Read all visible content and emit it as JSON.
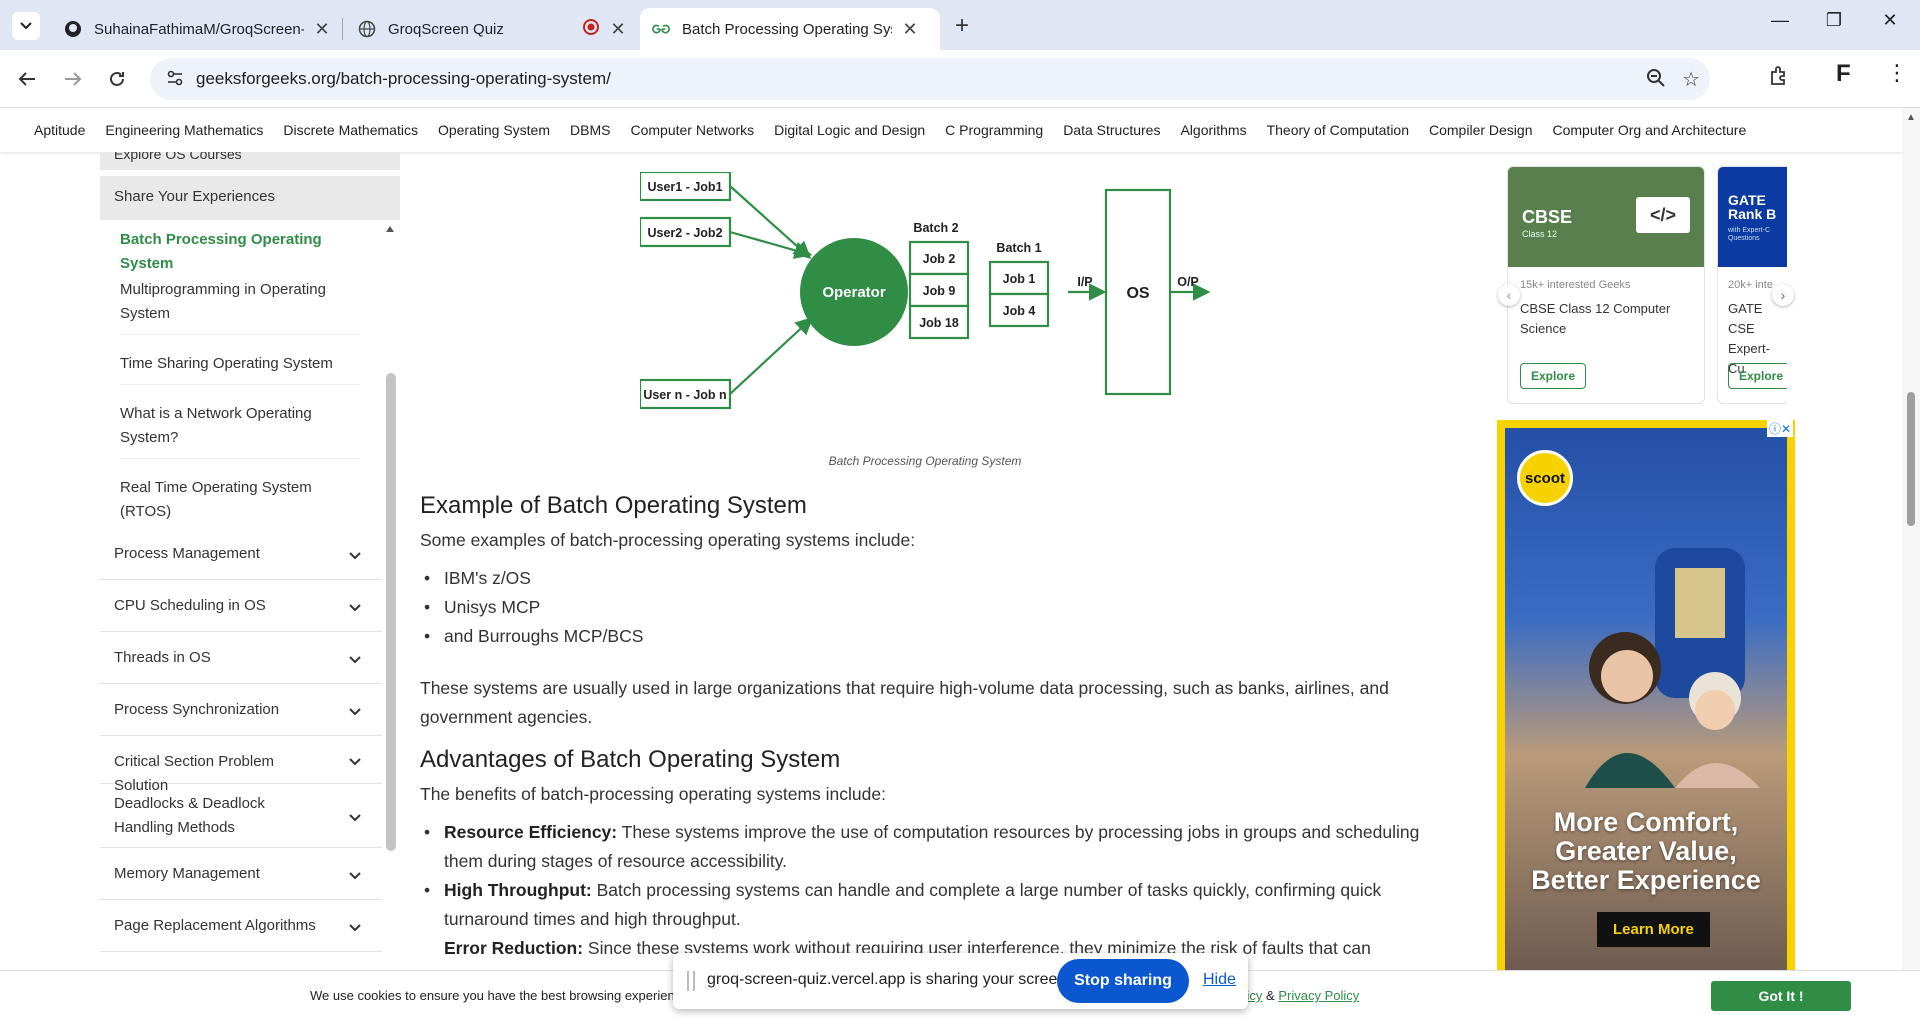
{
  "browser": {
    "tabs": [
      {
        "title": "SuhainaFathimaM/GroqScreen-",
        "icon": "github-icon"
      },
      {
        "title": "GroqScreen Quiz",
        "icon": "globe-icon"
      },
      {
        "title": "Batch Processing Operating Sys",
        "icon": "gfg-icon"
      }
    ],
    "url_domain": "geeksforgeeks.org",
    "url_path": "/batch-processing-operating-system/"
  },
  "topnav": [
    "Aptitude",
    "Engineering Mathematics",
    "Discrete Mathematics",
    "Operating System",
    "DBMS",
    "Computer Networks",
    "Digital Logic and Design",
    "C Programming",
    "Data Structures",
    "Algorithms",
    "Theory of Computation",
    "Compiler Design",
    "Computer Org and Architecture"
  ],
  "sidebar": {
    "cut_item": "Explore OS Courses",
    "share": "Share Your Experiences",
    "subitems": [
      "Batch Processing Operating System",
      "Multiprogramming in Operating System",
      "Time Sharing Operating System",
      "What is a Network Operating System?",
      "Real Time Operating System (RTOS)"
    ],
    "sections": [
      "Process Management",
      "CPU Scheduling in OS",
      "Threads in OS",
      "Process Synchronization",
      "Critical Section Problem Solution",
      "Deadlocks & Deadlock Handling Methods",
      "Memory Management",
      "Page Replacement Algorithms"
    ]
  },
  "diagram": {
    "users": [
      "User1 - Job1",
      "User2 - Job2",
      "User n - Job n"
    ],
    "operator": "Operator",
    "batch2_label": "Batch 2",
    "batch2_jobs": [
      "Job 2",
      "Job 9",
      "Job 18"
    ],
    "batch1_label": "Batch 1",
    "batch1_jobs": [
      "Job 1",
      "Job 4"
    ],
    "ip": "I/P",
    "os": "OS",
    "op": "O/P",
    "caption": "Batch Processing Operating System"
  },
  "content": {
    "h_example": "Example of Batch Operating System",
    "p_example": "Some examples of batch-processing operating systems include:",
    "examples": [
      "IBM's z/OS",
      "Unisys MCP",
      "and Burroughs MCP/BCS"
    ],
    "p_usage": "These systems are usually used in large organizations that require high-volume data processing, such as banks, airlines, and government agencies.",
    "h_adv": "Advantages of Batch Operating System",
    "p_adv": "The benefits of batch-processing operating systems include:",
    "advantages": [
      {
        "term": "Resource Efficiency:",
        "text": " These systems improve the use of computation resources by processing jobs in groups and scheduling them during stages of resource accessibility."
      },
      {
        "term": "High Throughput:",
        "text": " Batch processing systems can handle and complete a large number of tasks quickly, confirming quick turnaround times and high throughput."
      },
      {
        "term": "Error Reduction:",
        "text": " Since these systems work without requiring user interference, they minimize the risk of faults that can"
      }
    ]
  },
  "cards": [
    {
      "banner_title": "CBSE",
      "banner_sub": "Class 12",
      "meta": "15k+ interested Geeks",
      "title": "CBSE Class 12 Computer Science",
      "button": "Explore",
      "color": "#5a7f4f"
    },
    {
      "banner_title": "GATE Rank B",
      "banner_sub": "with Expert-C Questions",
      "meta": "20k+ inte",
      "title": "GATE CSE Expert-Cu",
      "button": "Explore",
      "color": "#0b3aa3"
    }
  ],
  "ad": {
    "brand": "scoot",
    "headline1": "More Comfort,",
    "headline2": "Greater Value,",
    "headline3": "Better Experience",
    "cta": "Learn More"
  },
  "cookie": {
    "message": "We use cookies to ensure you have the best browsing experience",
    "and": "&",
    "cookie_policy": "ie Policy",
    "privacy_policy": "Privacy Policy",
    "button": "Got It !"
  },
  "share_banner": {
    "text": "groq-screen-quiz.vercel.app is sharing your screen.",
    "stop": "Stop sharing",
    "hide": "Hide"
  },
  "colors": {
    "gfg_green": "#2f8d46",
    "chrome_blue": "#0b57d0"
  }
}
